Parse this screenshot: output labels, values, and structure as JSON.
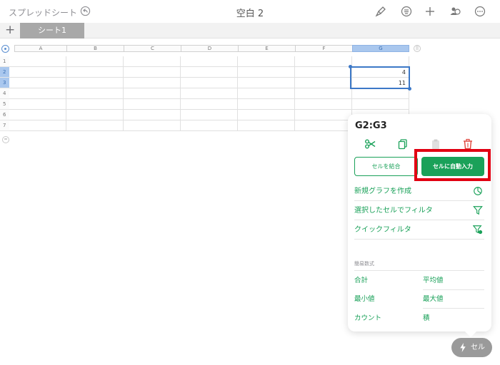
{
  "topbar": {
    "back_label": "スプレッドシート",
    "title": "空白 2",
    "icons": [
      "undo-icon",
      "paintbrush-icon",
      "list-icon",
      "plus-icon",
      "collaborate-icon",
      "more-icon"
    ]
  },
  "tabs": {
    "add_icon": "+",
    "sheets": [
      {
        "label": "シート1"
      }
    ]
  },
  "grid": {
    "columns": [
      "A",
      "B",
      "C",
      "D",
      "E",
      "F",
      "G"
    ],
    "rows": [
      "1",
      "2",
      "3",
      "4",
      "5",
      "6",
      "7"
    ],
    "selected_column": "G",
    "selected_rows": [
      "2",
      "3"
    ],
    "cells": {
      "G2": "4",
      "G3": "11"
    }
  },
  "panel": {
    "title": "G2:G3",
    "icons": [
      "scissors-icon",
      "copy-icon",
      "paste-icon",
      "trash-icon"
    ],
    "merge_label": "セルを結合",
    "autofill_label": "セルに自動入力",
    "menu": {
      "new_chart": "新規グラフを作成",
      "filter_selected": "選択したセルでフィルタ",
      "quick_filter": "クイックフィルタ"
    },
    "section_label": "簡易数式",
    "functions": {
      "sum": "合計",
      "average": "平均値",
      "min": "最小値",
      "max": "最大値",
      "count": "カウント",
      "product": "積"
    }
  },
  "cell_button": {
    "label": "セル"
  },
  "colors": {
    "accent": "#1aa159",
    "highlight": "#e10012",
    "selection": "#3c78c7"
  }
}
